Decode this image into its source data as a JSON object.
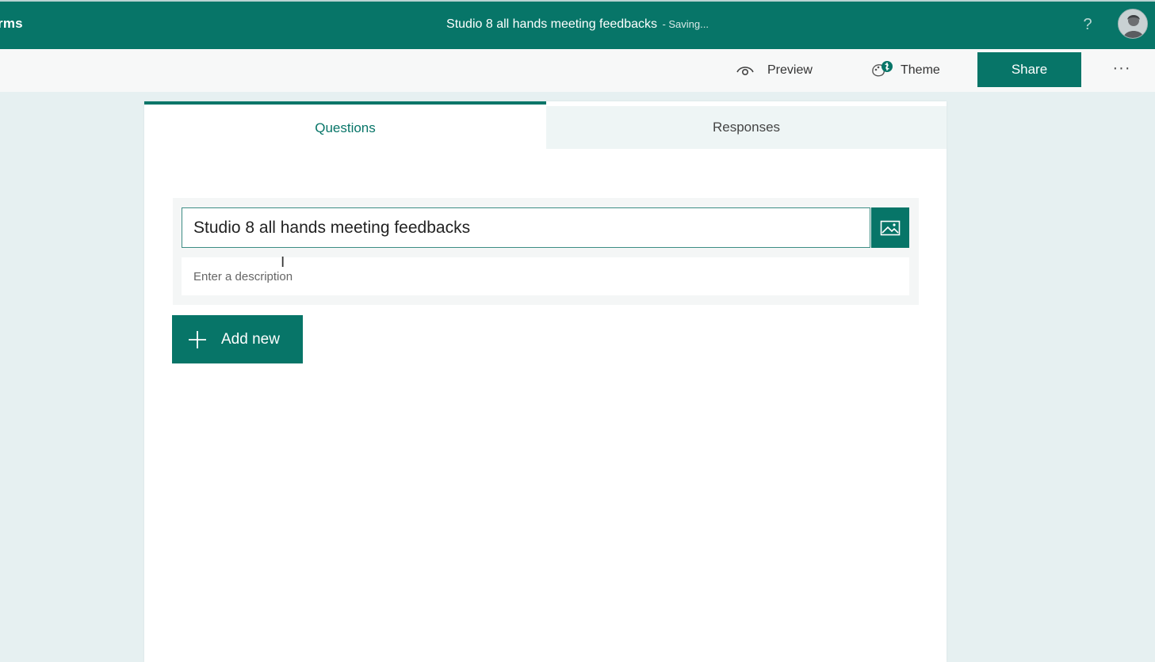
{
  "header": {
    "app_name": "rms",
    "form_title": "Studio 8 all hands meeting feedbacks",
    "save_status": "- Saving...",
    "help_label": "?"
  },
  "toolbar": {
    "preview_label": "Preview",
    "theme_label": "Theme",
    "share_label": "Share",
    "more_label": "···"
  },
  "tabs": [
    {
      "label": "Questions",
      "active": true
    },
    {
      "label": "Responses",
      "active": false
    }
  ],
  "form": {
    "title_value": "Studio 8 all hands meeting feedbacks",
    "description_placeholder": "Enter a description",
    "description_value": ""
  },
  "actions": {
    "add_new_label": "Add new"
  },
  "icons": {
    "help": "question-mark-icon",
    "avatar": "user-avatar",
    "preview": "eye-icon",
    "theme": "palette-icon",
    "more": "ellipsis-icon",
    "insert_image": "image-icon",
    "add": "plus-icon",
    "cursor": "text-cursor-icon"
  },
  "colors": {
    "brand": "#077568",
    "page_background": "#e6f0f1",
    "panel": "#ffffff"
  }
}
